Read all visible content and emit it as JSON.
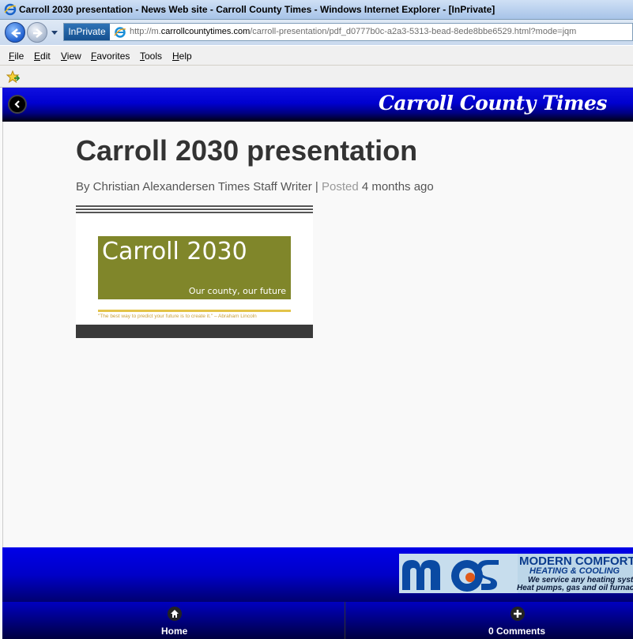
{
  "window": {
    "title": "Carroll 2030 presentation - News Web site - Carroll County Times - Windows Internet Explorer - [InPrivate]"
  },
  "addressbar": {
    "inprivate_label": "InPrivate",
    "url_prefix": "http://m.",
    "url_domain": "carrollcountytimes.com",
    "url_path": "/carroll-presentation/pdf_d0777b0c-a2a3-5313-bead-8ede8bbe6529.html?mode=jqm"
  },
  "menubar": {
    "items": [
      {
        "key": "F",
        "rest": "ile"
      },
      {
        "key": "E",
        "rest": "dit"
      },
      {
        "key": "V",
        "rest": "iew"
      },
      {
        "key": "F",
        "rest": "avorites",
        "pre": ""
      },
      {
        "key": "T",
        "rest": "ools"
      },
      {
        "key": "H",
        "rest": "elp"
      }
    ]
  },
  "site": {
    "logo_text": "Carroll County Times"
  },
  "article": {
    "headline": "Carroll 2030 presentation",
    "byline_author": "By Christian Alexandersen Times Staff Writer",
    "byline_sep": " | ",
    "byline_posted": "Posted",
    "byline_age": " 4 months ago"
  },
  "figure": {
    "title": "Carroll 2030",
    "subtitle": "Our county, our future",
    "quote": "\"The best way to predict your future is to create it.\" – Abraham Lincoln"
  },
  "ad": {
    "title": "MODERN COMFORT",
    "subtitle": "HEATING & COOLING",
    "line1": "We service any heating system.",
    "line2": "Heat pumps, gas and oil furnaces."
  },
  "bottomnav": {
    "home_label": "Home",
    "comments_label": "0 Comments"
  },
  "colors": {
    "header_blue": "#0000d0",
    "figure_green": "#80862a"
  }
}
